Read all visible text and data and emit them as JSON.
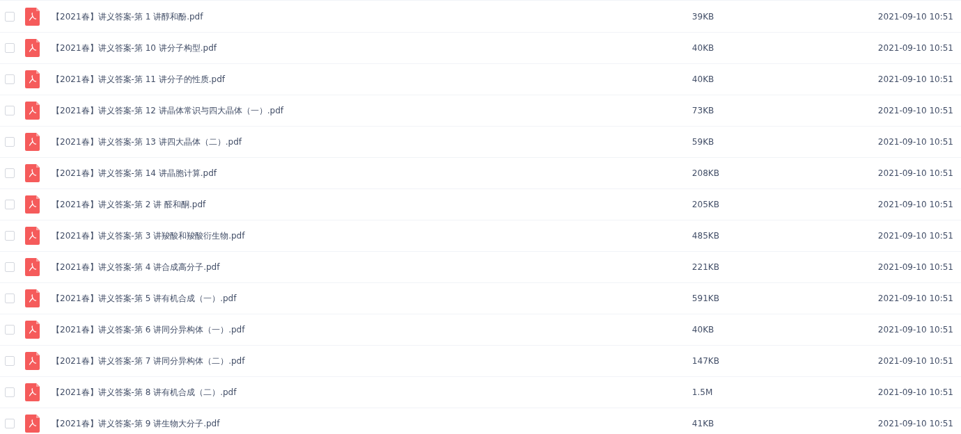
{
  "files": [
    {
      "name": "【2021春】讲义答案-第 1 讲醇和酚.pdf",
      "size": "39KB",
      "modified": "2021-09-10 10:51",
      "checked": false
    },
    {
      "name": "【2021春】讲义答案-第 10 讲分子构型.pdf",
      "size": "40KB",
      "modified": "2021-09-10 10:51",
      "checked": false
    },
    {
      "name": "【2021春】讲义答案-第 11 讲分子的性质.pdf",
      "size": "40KB",
      "modified": "2021-09-10 10:51",
      "checked": false
    },
    {
      "name": "【2021春】讲义答案-第 12 讲晶体常识与四大晶体（一）.pdf",
      "size": "73KB",
      "modified": "2021-09-10 10:51",
      "checked": false
    },
    {
      "name": "【2021春】讲义答案-第 13 讲四大晶体（二）.pdf",
      "size": "59KB",
      "modified": "2021-09-10 10:51",
      "checked": false
    },
    {
      "name": "【2021春】讲义答案-第 14 讲晶胞计算.pdf",
      "size": "208KB",
      "modified": "2021-09-10 10:51",
      "checked": false
    },
    {
      "name": "【2021春】讲义答案-第 2 讲 醛和酮.pdf",
      "size": "205KB",
      "modified": "2021-09-10 10:51",
      "checked": false
    },
    {
      "name": "【2021春】讲义答案-第 3 讲羧酸和羧酸衍生物.pdf",
      "size": "485KB",
      "modified": "2021-09-10 10:51",
      "checked": false
    },
    {
      "name": "【2021春】讲义答案-第 4 讲合成高分子.pdf",
      "size": "221KB",
      "modified": "2021-09-10 10:51",
      "checked": false
    },
    {
      "name": "【2021春】讲义答案-第 5 讲有机合成（一）.pdf",
      "size": "591KB",
      "modified": "2021-09-10 10:51",
      "checked": false
    },
    {
      "name": "【2021春】讲义答案-第 6 讲同分异构体（一）.pdf",
      "size": "40KB",
      "modified": "2021-09-10 10:51",
      "checked": false
    },
    {
      "name": "【2021春】讲义答案-第 7 讲同分异构体（二）.pdf",
      "size": "147KB",
      "modified": "2021-09-10 10:51",
      "checked": false
    },
    {
      "name": "【2021春】讲义答案-第 8 讲有机合成（二）.pdf",
      "size": "1.5M",
      "modified": "2021-09-10 10:51",
      "checked": false
    },
    {
      "name": "【2021春】讲义答案-第 9 讲生物大分子.pdf",
      "size": "41KB",
      "modified": "2021-09-10 10:51",
      "checked": false
    }
  ]
}
